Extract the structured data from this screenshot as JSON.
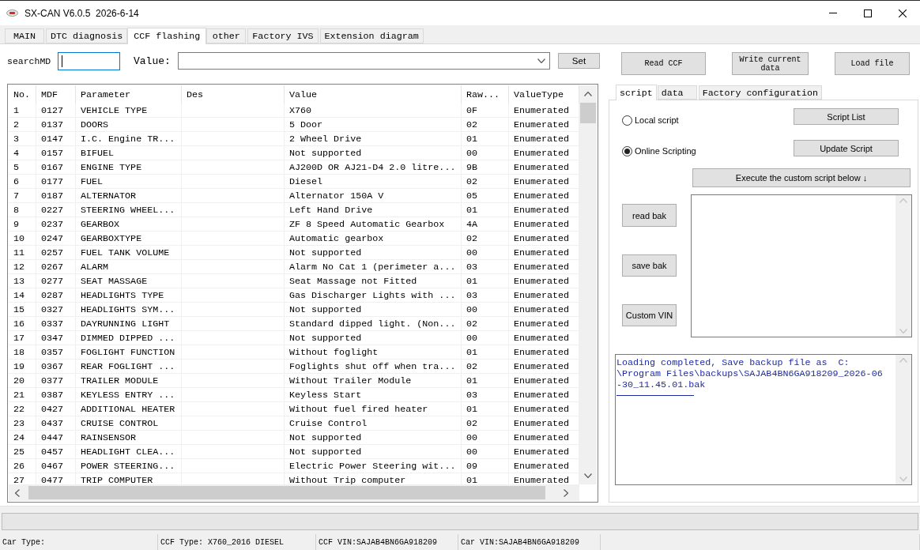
{
  "window": {
    "title": "SX-CAN V6.0.5  2026-6-14"
  },
  "tabs": [
    {
      "label": "MAIN",
      "selected": false
    },
    {
      "label": "DTC diagnosis",
      "selected": false
    },
    {
      "label": "CCF flashing",
      "selected": true
    },
    {
      "label": "other",
      "selected": false
    },
    {
      "label": "Factory IVS",
      "selected": false
    },
    {
      "label": "Extension diagram",
      "selected": false
    }
  ],
  "search": {
    "label": "searchMD",
    "focused": true
  },
  "value_field": {
    "label": "Value:"
  },
  "set_button": "Set",
  "actions": [
    "Read CCF",
    "Write current data",
    "Load file"
  ],
  "table": {
    "columns": [
      "No.",
      "MDF",
      "Parameter",
      "Des",
      "Value",
      "Raw...",
      "ValueType"
    ],
    "rows": [
      {
        "no": "1",
        "mdf": "0127",
        "parameter": "VEHICLE TYPE",
        "value": "X760",
        "raw": "0F",
        "value_type": "Enumerated"
      },
      {
        "no": "2",
        "mdf": "0137",
        "parameter": "DOORS",
        "value": "5 Door",
        "raw": "02",
        "value_type": "Enumerated"
      },
      {
        "no": "3",
        "mdf": "0147",
        "parameter": "I.C. Engine TR...",
        "value": "2 Wheel Drive",
        "raw": "01",
        "value_type": "Enumerated"
      },
      {
        "no": "4",
        "mdf": "0157",
        "parameter": "BIFUEL",
        "value": "Not supported",
        "raw": "00",
        "value_type": "Enumerated"
      },
      {
        "no": "5",
        "mdf": "0167",
        "parameter": "ENGINE TYPE",
        "value": "AJ200D OR AJ21-D4 2.0 litre...",
        "raw": "9B",
        "value_type": "Enumerated"
      },
      {
        "no": "6",
        "mdf": "0177",
        "parameter": "FUEL",
        "value": "Diesel",
        "raw": "02",
        "value_type": "Enumerated"
      },
      {
        "no": "7",
        "mdf": "0187",
        "parameter": "ALTERNATOR",
        "value": "Alternator 150A V",
        "raw": "05",
        "value_type": "Enumerated"
      },
      {
        "no": "8",
        "mdf": "0227",
        "parameter": "STEERING WHEEL...",
        "value": "Left Hand Drive",
        "raw": "01",
        "value_type": "Enumerated"
      },
      {
        "no": "9",
        "mdf": "0237",
        "parameter": "GEARBOX",
        "value": "ZF 8 Speed Automatic Gearbox",
        "raw": "4A",
        "value_type": "Enumerated"
      },
      {
        "no": "10",
        "mdf": "0247",
        "parameter": "GEARBOXTYPE",
        "value": "Automatic gearbox",
        "raw": "02",
        "value_type": "Enumerated"
      },
      {
        "no": "11",
        "mdf": "0257",
        "parameter": "FUEL TANK VOLUME",
        "value": "Not supported",
        "raw": "00",
        "value_type": "Enumerated"
      },
      {
        "no": "12",
        "mdf": "0267",
        "parameter": "ALARM",
        "value": "Alarm No Cat 1 (perimeter a...",
        "raw": "03",
        "value_type": "Enumerated"
      },
      {
        "no": "13",
        "mdf": "0277",
        "parameter": "SEAT MASSAGE",
        "value": "Seat Massage not Fitted",
        "raw": "01",
        "value_type": "Enumerated"
      },
      {
        "no": "14",
        "mdf": "0287",
        "parameter": "HEADLIGHTS TYPE",
        "value": "Gas Discharger Lights with ...",
        "raw": "03",
        "value_type": "Enumerated"
      },
      {
        "no": "15",
        "mdf": "0327",
        "parameter": "HEADLIGHTS SYM...",
        "value": "Not supported",
        "raw": "00",
        "value_type": "Enumerated"
      },
      {
        "no": "16",
        "mdf": "0337",
        "parameter": "DAYRUNNING LIGHT",
        "value": "Standard dipped light. (Non...",
        "raw": "02",
        "value_type": "Enumerated"
      },
      {
        "no": "17",
        "mdf": "0347",
        "parameter": "DIMMED DIPPED ...",
        "value": "Not supported",
        "raw": "00",
        "value_type": "Enumerated"
      },
      {
        "no": "18",
        "mdf": "0357",
        "parameter": "FOGLIGHT FUNCTION",
        "value": "Without foglight",
        "raw": "01",
        "value_type": "Enumerated"
      },
      {
        "no": "19",
        "mdf": "0367",
        "parameter": "REAR FOGLIGHT ...",
        "value": "Foglights shut off when tra...",
        "raw": "02",
        "value_type": "Enumerated"
      },
      {
        "no": "20",
        "mdf": "0377",
        "parameter": "TRAILER MODULE",
        "value": "Without Trailer Module",
        "raw": "01",
        "value_type": "Enumerated"
      },
      {
        "no": "21",
        "mdf": "0387",
        "parameter": "KEYLESS ENTRY ...",
        "value": "Keyless Start",
        "raw": "03",
        "value_type": "Enumerated"
      },
      {
        "no": "22",
        "mdf": "0427",
        "parameter": "ADDITIONAL HEATER",
        "value": "Without fuel fired heater",
        "raw": "01",
        "value_type": "Enumerated"
      },
      {
        "no": "23",
        "mdf": "0437",
        "parameter": "CRUISE CONTROL",
        "value": "Cruise Control",
        "raw": "02",
        "value_type": "Enumerated"
      },
      {
        "no": "24",
        "mdf": "0447",
        "parameter": "RAINSENSOR",
        "value": "Not supported",
        "raw": "00",
        "value_type": "Enumerated"
      },
      {
        "no": "25",
        "mdf": "0457",
        "parameter": "HEADLIGHT CLEA...",
        "value": "Not supported",
        "raw": "00",
        "value_type": "Enumerated"
      },
      {
        "no": "26",
        "mdf": "0467",
        "parameter": "POWER STEERING...",
        "value": "Electric Power Steering wit...",
        "raw": "09",
        "value_type": "Enumerated"
      },
      {
        "no": "27",
        "mdf": "0477",
        "parameter": "TRIP COMPUTER",
        "value": "Without Trip computer",
        "raw": "01",
        "value_type": "Enumerated"
      }
    ]
  },
  "side_tabs": [
    {
      "label": "script",
      "selected": true
    },
    {
      "label": "data",
      "selected": false
    },
    {
      "label": "Factory configuration",
      "selected": false
    }
  ],
  "script_panel": {
    "sources": [
      {
        "label": "Local script",
        "selected": false
      },
      {
        "label": "Online Scripting",
        "selected": true
      }
    ],
    "script_buttons": [
      "Script List",
      "Update Script"
    ],
    "execute_button": "Execute the custom script below ↓",
    "backup_buttons": [
      "read bak",
      "save bak",
      "Custom VIN"
    ],
    "log": {
      "lines": [
        "Loading completed, Save backup file as  C:",
        "\\Program Files\\backups\\SAJAB4BN6GA918209_2026-06",
        "-30_11.45.01.bak"
      ]
    }
  },
  "progress": {
    "level": 0
  },
  "status_bar": [
    "Car Type:",
    "CCF Type: X760_2016 DIESEL",
    "CCF VIN:SAJAB4BN6GA918209",
    "Car VIN:SAJAB4BN6GA918209"
  ]
}
